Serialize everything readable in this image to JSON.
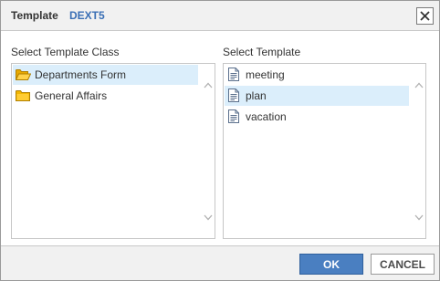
{
  "titlebar": {
    "title": "Template",
    "brand": "DEXT5"
  },
  "left_panel": {
    "label": "Select Template Class",
    "items": [
      {
        "label": "Departments Form",
        "icon": "folder-open-icon",
        "selected": true
      },
      {
        "label": "General Affairs",
        "icon": "folder-icon",
        "selected": false
      }
    ]
  },
  "right_panel": {
    "label": "Select Template",
    "items": [
      {
        "label": "meeting",
        "icon": "document-icon",
        "selected": false
      },
      {
        "label": "plan",
        "icon": "document-icon",
        "selected": true
      },
      {
        "label": "vacation",
        "icon": "document-icon",
        "selected": false
      }
    ]
  },
  "footer": {
    "ok_label": "OK",
    "cancel_label": "CANCEL"
  },
  "colors": {
    "accent": "#4a7fc1",
    "brand": "#3a6fb5",
    "selection": "#dbeefb",
    "folder": "#f2b600"
  }
}
